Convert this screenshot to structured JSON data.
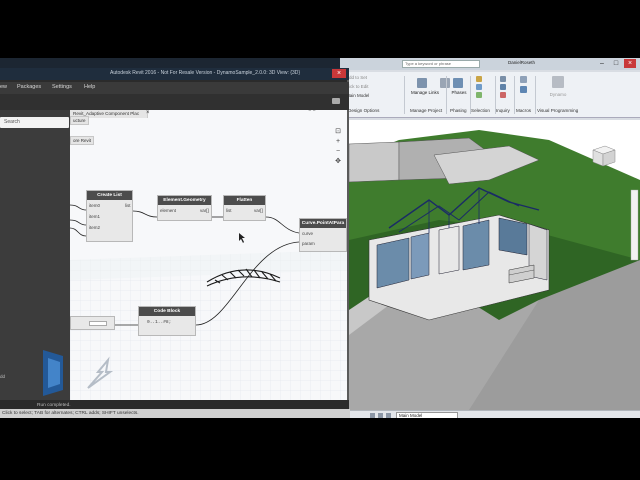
{
  "dynamo": {
    "window_title": "Autodesk Revit 2016 - Not For Resale Version - DynamoSample_2.0.0: 3D View: {3D}",
    "menu": [
      {
        "label": "ew"
      },
      {
        "label": "Packages"
      },
      {
        "label": "Settings"
      },
      {
        "label": "Help"
      }
    ],
    "search_placeholder": "Search",
    "library_bottom_label": "dd",
    "workspace_tab": "Revit_Adaptive Component Plac",
    "partial_nodes": [
      "ucture",
      "ore Revit"
    ],
    "nodes": {
      "create_list": {
        "title": "Create List",
        "inputs": [
          "item0",
          "item1",
          "item2"
        ],
        "output": "list"
      },
      "element_geometry": {
        "title": "Element.Geometry",
        "inputs": [
          "element"
        ],
        "output": "var[]"
      },
      "flatten": {
        "title": "Flatten",
        "inputs": [
          "list"
        ],
        "output": "var[]"
      },
      "curve_point": {
        "title": "Curve.PointAtPara",
        "inputs": [
          "curve",
          "param"
        ]
      },
      "code_block": {
        "title": "Code Block",
        "code": "0..1..#8;"
      }
    },
    "run_status": "Run completed.",
    "bottom_status": "Click to select; TAB for alternates; CTRL adds; SHIFT unselects."
  },
  "revit": {
    "search_placeholder": "Type a keyword or phrase",
    "user": "DanielRoseth",
    "ribbon": {
      "small_items": [
        "Add to Set",
        "Pick to Edit",
        "Main Model"
      ],
      "buttons": [
        {
          "label": "Manage Links"
        },
        {
          "label": "Phases"
        },
        {
          "label": "Dynamo"
        }
      ],
      "panels": [
        "Design Options",
        "Manage Project",
        "Phasing",
        "Selection",
        "Inquiry",
        "Macros",
        "Visual Programming"
      ]
    },
    "view_dropdown": "Main Model",
    "colors": {
      "grass": "#3d7a2a",
      "road": "#9c9c9c",
      "house_wall": "#e6e6e6",
      "glass": "#6b8caa"
    }
  }
}
